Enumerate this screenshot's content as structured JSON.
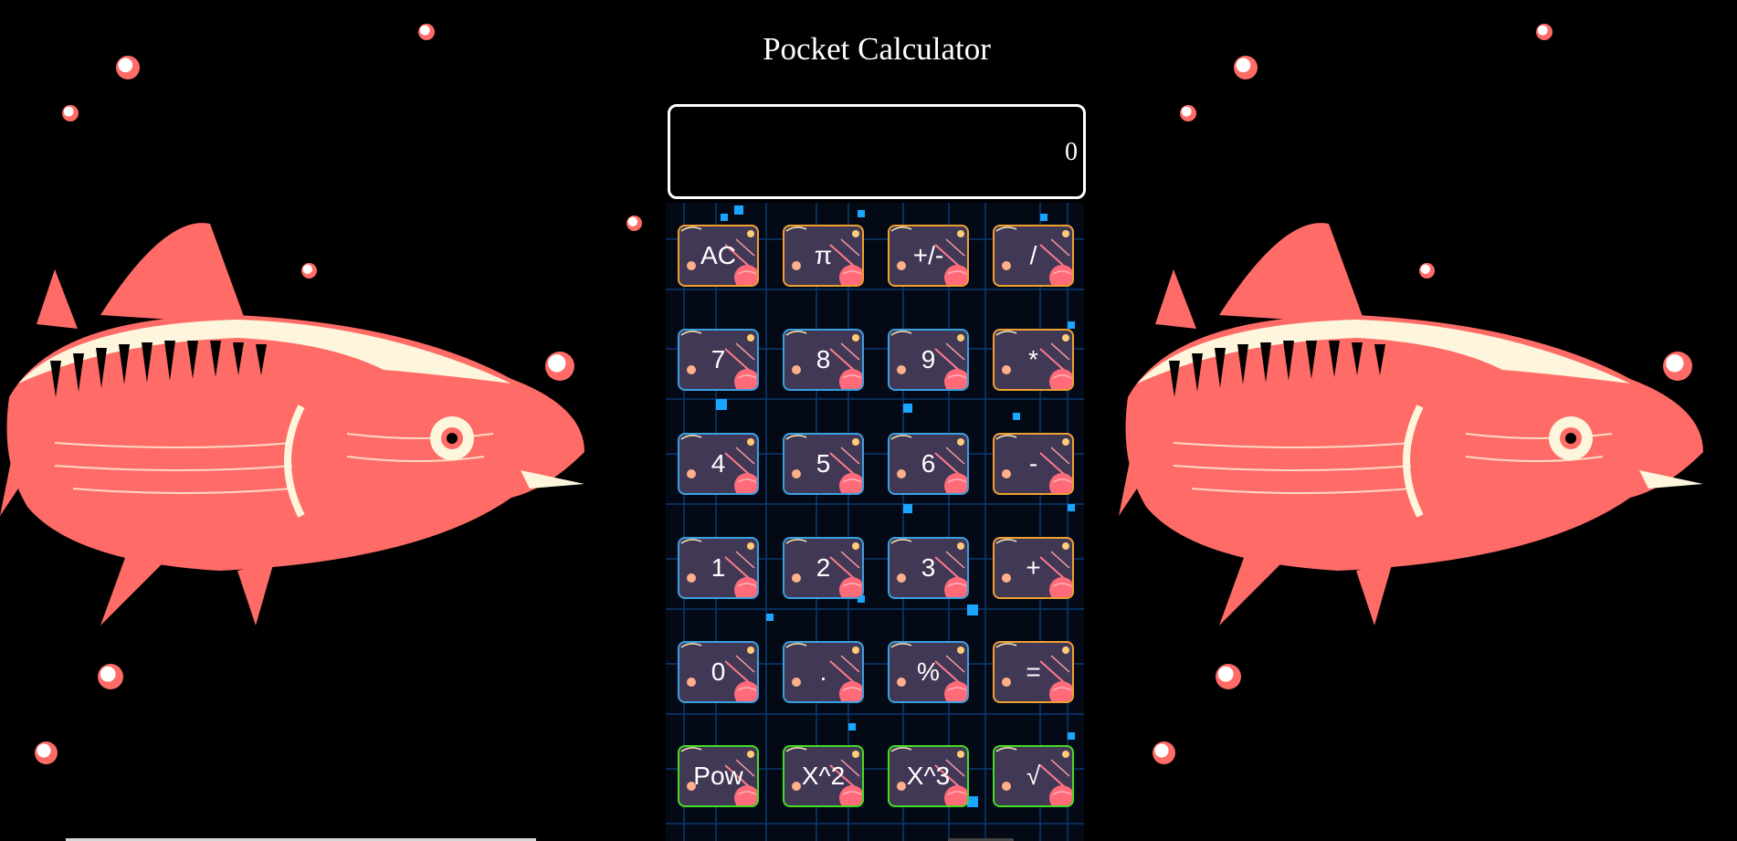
{
  "page": {
    "title": "Pocket Calculator"
  },
  "display": {
    "value": "0"
  },
  "keys": [
    {
      "label": "AC",
      "name": "ac-button",
      "kind": "op"
    },
    {
      "label": "π",
      "name": "pi-button",
      "kind": "op"
    },
    {
      "label": "+/-",
      "name": "sign-toggle-button",
      "kind": "op"
    },
    {
      "label": "/",
      "name": "divide-button",
      "kind": "op"
    },
    {
      "label": "7",
      "name": "digit-7-button",
      "kind": "num"
    },
    {
      "label": "8",
      "name": "digit-8-button",
      "kind": "num"
    },
    {
      "label": "9",
      "name": "digit-9-button",
      "kind": "num"
    },
    {
      "label": "*",
      "name": "multiply-button",
      "kind": "op"
    },
    {
      "label": "4",
      "name": "digit-4-button",
      "kind": "num"
    },
    {
      "label": "5",
      "name": "digit-5-button",
      "kind": "num"
    },
    {
      "label": "6",
      "name": "digit-6-button",
      "kind": "num"
    },
    {
      "label": "-",
      "name": "subtract-button",
      "kind": "op"
    },
    {
      "label": "1",
      "name": "digit-1-button",
      "kind": "num"
    },
    {
      "label": "2",
      "name": "digit-2-button",
      "kind": "num"
    },
    {
      "label": "3",
      "name": "digit-3-button",
      "kind": "num"
    },
    {
      "label": "+",
      "name": "add-button",
      "kind": "op"
    },
    {
      "label": "0",
      "name": "digit-0-button",
      "kind": "num"
    },
    {
      "label": ".",
      "name": "decimal-button",
      "kind": "num"
    },
    {
      "label": "%",
      "name": "percent-button",
      "kind": "num"
    },
    {
      "label": "=",
      "name": "equals-button",
      "kind": "op"
    },
    {
      "label": "Pow",
      "name": "power-button",
      "kind": "fn"
    },
    {
      "label": "X^2",
      "name": "square-button",
      "kind": "fn"
    },
    {
      "label": "X^3",
      "name": "cube-button",
      "kind": "fn"
    },
    {
      "label": "√",
      "name": "sqrt-button",
      "kind": "fn"
    }
  ],
  "colors": {
    "background": "#000000",
    "fish_body": "#ff6b66",
    "fish_accent": "#fdf6dc",
    "key_fill": "#413856",
    "key_border_operator": "#f0a030",
    "key_border_number": "#3aa0e0",
    "key_border_function": "#44dd22"
  }
}
